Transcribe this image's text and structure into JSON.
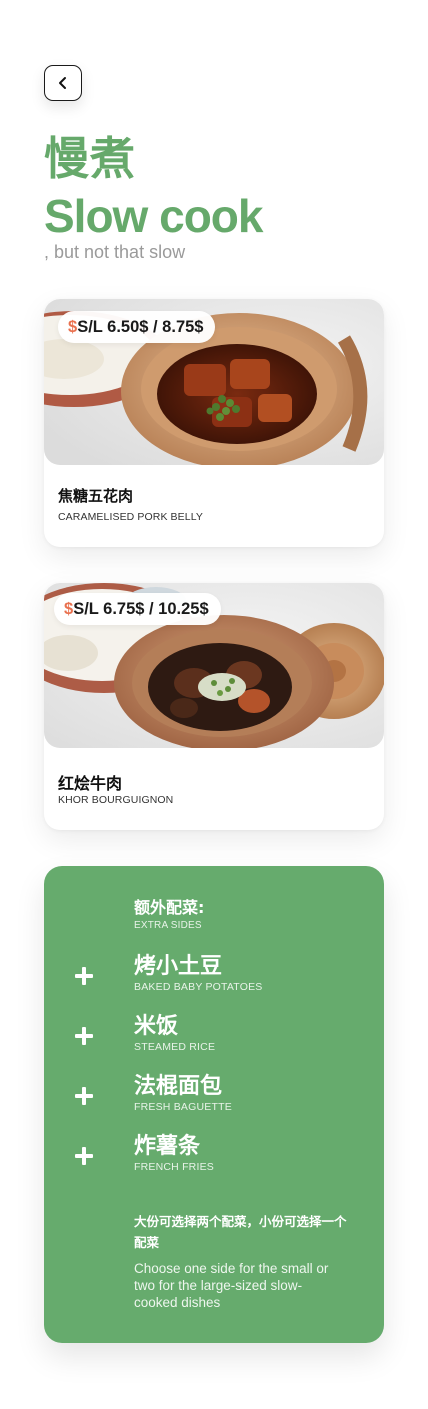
{
  "header": {
    "back_icon": "chevron-left-icon",
    "title_cn": "慢煮",
    "title_en": "Slow cook",
    "subtitle": ", but not that slow"
  },
  "colors": {
    "brand_green": "#66a96b",
    "price_dollar": "#e9714f",
    "subtitle_gray": "#9a9a9a"
  },
  "dishes": [
    {
      "price_symbol": "$",
      "price_text": "S/L 6.50$ / 8.75$",
      "name_cn": "焦糖五花肉",
      "name_en": "CARAMELISED PORK BELLY"
    },
    {
      "price_symbol": "$",
      "price_text": "S/L 6.75$ / 10.25$",
      "name_cn": "红烩牛肉",
      "name_en": "KHOR BOURGUIGNON"
    }
  ],
  "sides": {
    "heading_cn": "额外配菜:",
    "heading_en": "EXTRA SIDES",
    "items": [
      {
        "icon": "plus-icon",
        "name_cn": "烤小土豆",
        "name_en": "BAKED BABY POTATOES"
      },
      {
        "icon": "plus-icon",
        "name_cn": "米饭",
        "name_en": "STEAMED RICE"
      },
      {
        "icon": "plus-icon",
        "name_cn": "法棍面包",
        "name_en": "FRESH BAGUETTE"
      },
      {
        "icon": "plus-icon",
        "name_cn": "炸薯条",
        "name_en": "FRENCH FRIES"
      }
    ],
    "note_cn": "大份可选择两个配菜，小份可选择一个配菜",
    "note_en": "Choose one side for the small or two for the large-sized slow-cooked dishes"
  }
}
